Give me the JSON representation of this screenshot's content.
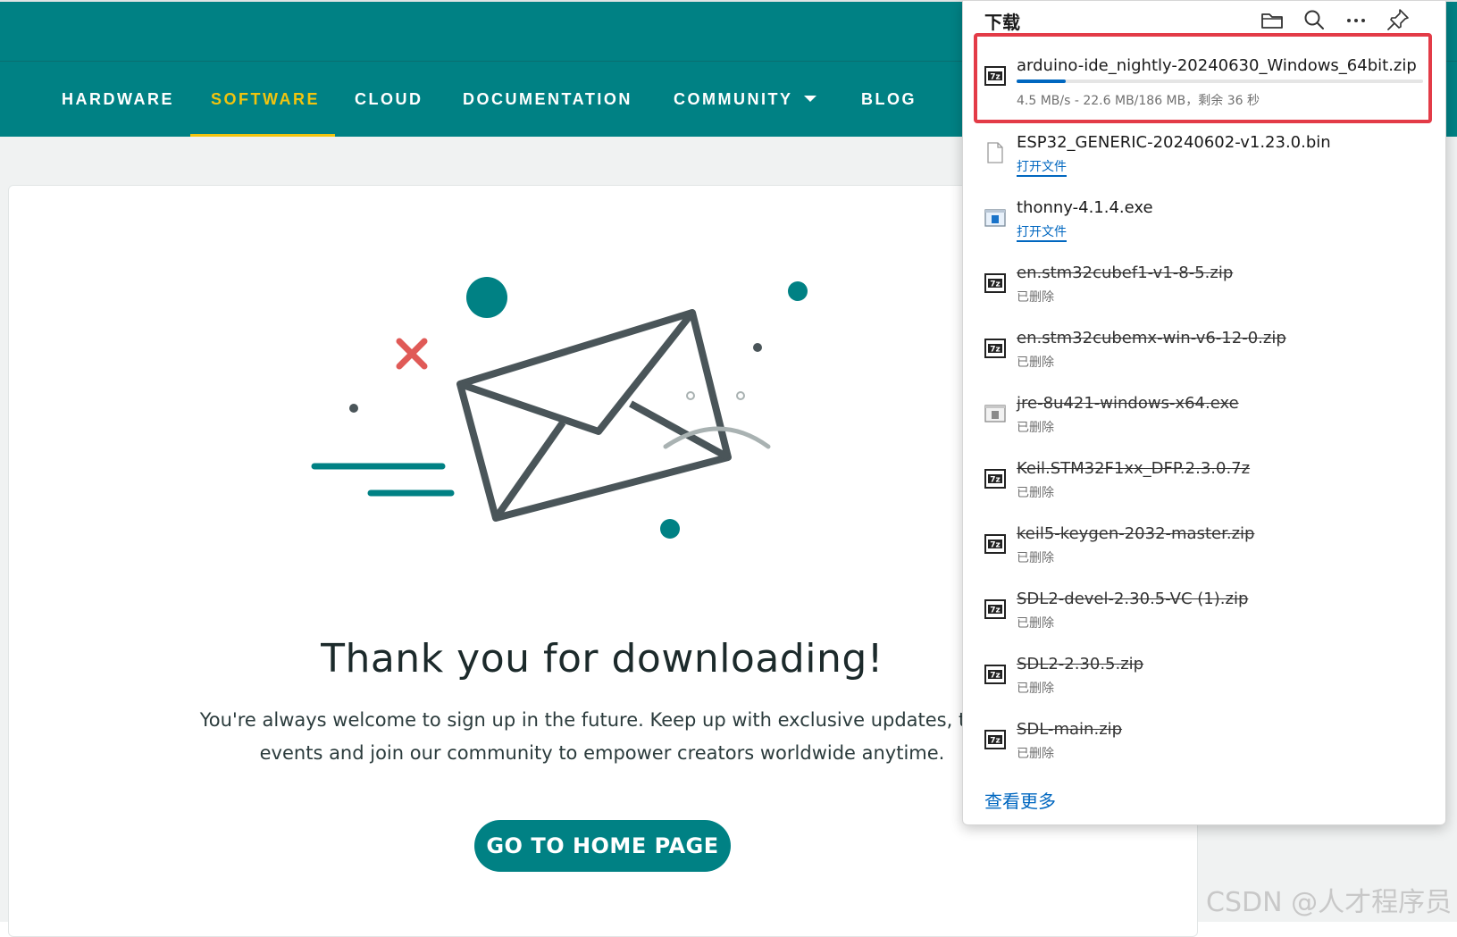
{
  "site": {
    "nav": [
      {
        "label": "HARDWARE",
        "active": false
      },
      {
        "label": "SOFTWARE",
        "active": true
      },
      {
        "label": "CLOUD",
        "active": false
      },
      {
        "label": "DOCUMENTATION",
        "active": false
      },
      {
        "label": "COMMUNITY",
        "active": false,
        "has_dropdown": true
      },
      {
        "label": "BLOG",
        "active": false
      }
    ],
    "brand_color": "#008184",
    "accent_color": "#f1c40f",
    "heading": "Thank you for downloading!",
    "body_line1": "You're always welcome to sign up in the future. Keep up with exclusive updates, tutor",
    "body_line2": "events and join our community to empower creators worldwide anytime.",
    "home_button": "GO TO HOME PAGE"
  },
  "downloads": {
    "title": "下载",
    "header_icons": [
      "folder-icon",
      "search-icon",
      "more-icon",
      "pin-icon"
    ],
    "active": {
      "name": "arduino-ide_nightly-20240630_Windows_64bit.zip",
      "status": "4.5 MB/s - 22.6 MB/186 MB，剩余 36 秒",
      "progress": 0.12,
      "icon": "7z-archive-icon"
    },
    "items": [
      {
        "name": "ESP32_GENERIC-20240602-v1.23.0.bin",
        "action": "打开文件",
        "deleted": false,
        "icon": "blank-file-icon"
      },
      {
        "name": "thonny-4.1.4.exe",
        "action": "打开文件",
        "deleted": false,
        "icon": "exe-window-icon"
      },
      {
        "name": "en.stm32cubef1-v1-8-5.zip",
        "status": "已删除",
        "deleted": true,
        "icon": "7z-archive-icon"
      },
      {
        "name": "en.stm32cubemx-win-v6-12-0.zip",
        "status": "已删除",
        "deleted": true,
        "icon": "7z-archive-icon"
      },
      {
        "name": "jre-8u421-windows-x64.exe",
        "status": "已删除",
        "deleted": true,
        "icon": "exe-gray-icon"
      },
      {
        "name": "Keil.STM32F1xx_DFP.2.3.0.7z",
        "status": "已删除",
        "deleted": true,
        "icon": "7z-archive-icon"
      },
      {
        "name": "keil5-keygen-2032-master.zip",
        "status": "已删除",
        "deleted": true,
        "icon": "7z-archive-icon"
      },
      {
        "name": "SDL2-devel-2.30.5-VC (1).zip",
        "status": "已删除",
        "deleted": true,
        "icon": "7z-archive-icon"
      },
      {
        "name": "SDL2-2.30.5.zip",
        "status": "已删除",
        "deleted": true,
        "icon": "7z-archive-icon"
      },
      {
        "name": "SDL-main.zip",
        "status": "已删除",
        "deleted": true,
        "icon": "7z-archive-icon"
      }
    ],
    "see_more": "查看更多",
    "highlight_color": "#e33b47"
  },
  "watermark": "CSDN @人才程序员"
}
